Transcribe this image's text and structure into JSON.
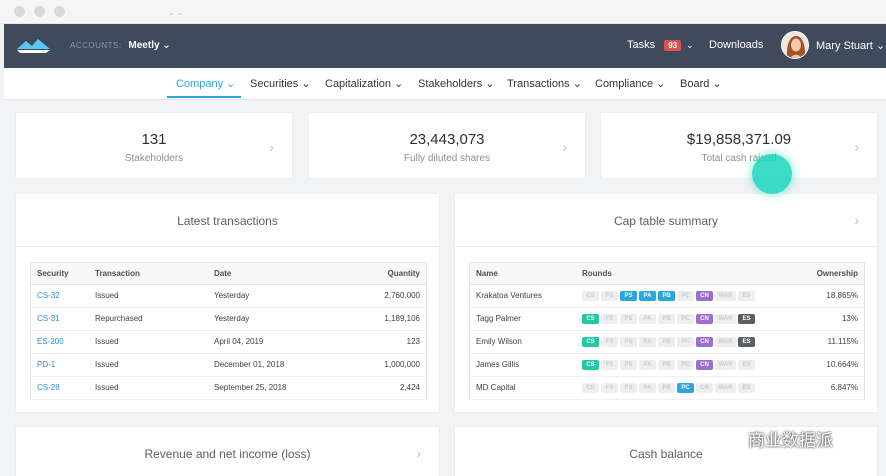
{
  "window": {
    "tiny": "⌄  ⌄"
  },
  "topbar": {
    "accounts_label": "ACCOUNTS:",
    "account_name": "Meetly ⌄",
    "tasks_label": "Tasks",
    "tasks_count": "93",
    "tasks_chevron": "⌄",
    "downloads_label": "Downloads",
    "user_name": "Mary Stuart ⌄"
  },
  "nav": [
    {
      "label": "Company ⌄",
      "active": true
    },
    {
      "label": "Securities ⌄"
    },
    {
      "label": "Capitalization ⌄"
    },
    {
      "label": "Stakeholders ⌄"
    },
    {
      "label": "Transactions ⌄"
    },
    {
      "label": "Compliance ⌄"
    },
    {
      "label": "Board ⌄"
    }
  ],
  "stats": [
    {
      "value": "131",
      "label": "Stakeholders"
    },
    {
      "value": "23,443,073",
      "label": "Fully diluted shares"
    },
    {
      "value": "$19,858,371.09",
      "label": "Total cash raised"
    }
  ],
  "transactions": {
    "title": "Latest transactions",
    "headers": [
      "Security",
      "Transaction",
      "Date",
      "Quantity"
    ],
    "rows": [
      [
        "CS-32",
        "Issued",
        "Yesterday",
        "2,760,000"
      ],
      [
        "CS-31",
        "Repurchased",
        "Yesterday",
        "1,189,106"
      ],
      [
        "ES-200",
        "Issued",
        "April 04, 2019",
        "123"
      ],
      [
        "PD-1",
        "Issued",
        "December 01, 2018",
        "1,000,000"
      ],
      [
        "CS-28",
        "Issued",
        "September 25, 2018",
        "2,424"
      ]
    ]
  },
  "captable": {
    "title": "Cap table summary",
    "headers": [
      "Name",
      "Rounds",
      "Ownership"
    ],
    "chip_labels": [
      "CS",
      "FS",
      "PS",
      "PA",
      "PB",
      "PC",
      "CN",
      "WAR",
      "ES"
    ],
    "chip_colors": {
      "CS": "#23c9a3",
      "FS": "#23c9a3",
      "PS": "#2aa6df",
      "PA": "#2aa6df",
      "PB": "#2aa6df",
      "PC": "#2aa6df",
      "CN": "#9b6fd0",
      "WAR": "#8a9099",
      "ES": "#5a5f66"
    },
    "rows": [
      {
        "name": "Krakatoa Ventures",
        "active": [
          "PS",
          "PA",
          "PB",
          "CN"
        ],
        "ownership": "18.865%"
      },
      {
        "name": "Tagg Palmer",
        "active": [
          "CS",
          "CN",
          "ES"
        ],
        "ownership": "13%"
      },
      {
        "name": "Emily Wilson",
        "active": [
          "CS",
          "CN",
          "ES"
        ],
        "ownership": "11.115%"
      },
      {
        "name": "James Gillis",
        "active": [
          "CS",
          "CN"
        ],
        "ownership": "10.664%"
      },
      {
        "name": "MD Capital",
        "active": [
          "PC"
        ],
        "ownership": "6.847%"
      }
    ]
  },
  "bottom": {
    "revenue_title": "Revenue and net income (loss)",
    "cash_title": "Cash balance"
  },
  "watermark": "商业数据派",
  "colors": {
    "topbar": "#3f4a5c",
    "accent": "#2aa6df",
    "cursor": "#1ad6bd"
  }
}
